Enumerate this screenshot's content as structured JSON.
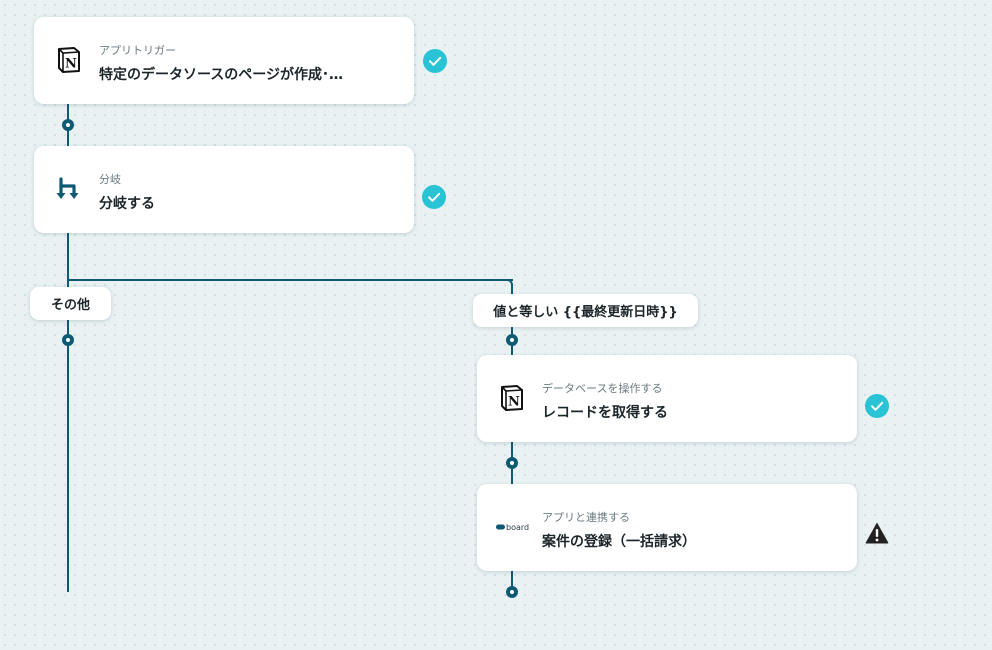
{
  "flow": {
    "trigger": {
      "type_label": "アプリトリガー",
      "title": "特定のデータソースのページが作成･…",
      "app_icon": "notion-icon",
      "status": "success"
    },
    "branch": {
      "type_label": "分岐",
      "title": "分岐する",
      "app_icon": "branch-icon",
      "status": "success"
    },
    "branches": [
      {
        "label": "その他"
      },
      {
        "label": "値と等しい {{最終更新日時}}",
        "steps": [
          {
            "type_label": "データベースを操作する",
            "title": "レコードを取得する",
            "app_icon": "notion-icon",
            "status": "success"
          },
          {
            "type_label": "アプリと連携する",
            "title": "案件の登録（一括請求）",
            "app_icon": "board-logo-icon",
            "logo_text": "board",
            "status": "warning"
          }
        ]
      }
    ]
  },
  "colors": {
    "connector": "#0e5a73",
    "success": "#29c3d6",
    "warning": "#222222",
    "background": "#e9f1f3"
  }
}
